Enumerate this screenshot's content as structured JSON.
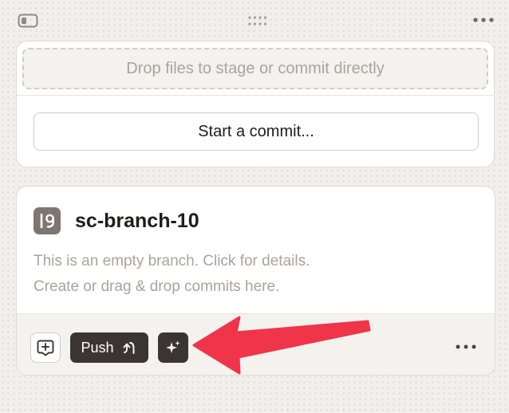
{
  "toolbar": {
    "panel_toggle_icon": "sidebar-panel-icon",
    "drag_handle_icon": "drag-grip-icon",
    "more_icon": "ellipsis-icon"
  },
  "commit_panel": {
    "drop_zone_text": "Drop files to stage or commit directly",
    "start_commit_label": "Start a commit..."
  },
  "branch": {
    "name": "sc-branch-10",
    "badge_icon": "branch-lane-icon",
    "description_lines": [
      "This is an empty branch. Click for details.",
      "Create or drag & drop commits here."
    ],
    "actions": {
      "review_icon": "add-review-icon",
      "push_label": "Push",
      "push_icon": "push-arrow-icon",
      "ai_icon": "sparkle-icon",
      "more_icon": "ellipsis-icon"
    }
  },
  "annotation": {
    "arrow_color": "#f0354a"
  },
  "colors": {
    "background": "#f1efec",
    "card": "#ffffff",
    "dark_button": "#3a3532",
    "badge": "#7d7570",
    "muted_text": "#a8a39d"
  }
}
